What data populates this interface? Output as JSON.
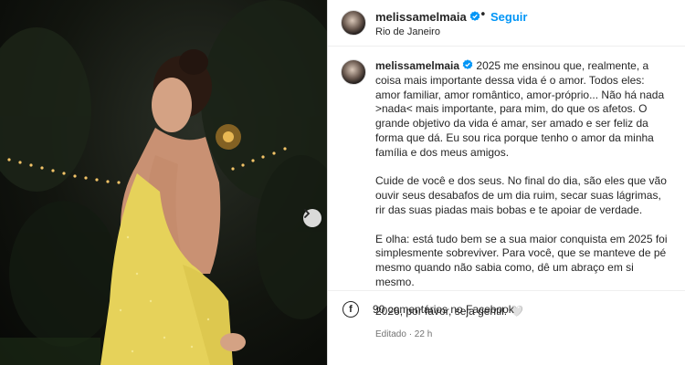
{
  "post": {
    "username": "melissamelmaia",
    "follow_label": "Seguir",
    "separator": "•",
    "location": "Rio de Janeiro"
  },
  "caption": {
    "username": "melissamelmaia",
    "paragraphs": [
      "2025 me ensinou que, realmente, a coisa mais importante dessa vida é o amor. Todos eles: amor familiar, amor romântico, amor-próprio... Não há nada >nada< mais importante, para mim, do que os afetos. O grande objetivo da vida é amar, ser amado e ser feliz da forma que dá. Eu sou rica porque tenho o amor da minha família e dos meus amigos.",
      "Cuide de você e dos seus. No final do dia, são eles que vão ouvir seus desabafos de um dia ruim, secar suas lágrimas, rir das suas piadas mais bobas e te apoiar de verdade.",
      "E olha: está tudo bem se a sua maior conquista em 2025 foi simplesmente sobreviver. Para você, que se manteve de pé mesmo quando não sabia como, dê um abraço em si mesmo.",
      "2026, por favor, seja gentil. 🤍"
    ],
    "meta": "Editado · 22 h"
  },
  "comments": {
    "label": "90 comentários no Facebook",
    "icon": "facebook-icon"
  },
  "icons": {
    "verified": "verified-badge-icon",
    "next": "chevron-right-icon",
    "more": "more-options-icon"
  },
  "colors": {
    "link": "#0095f6",
    "verified": "#0095f6",
    "text": "#262626",
    "muted": "#737373",
    "dress": "#e9d65a"
  }
}
